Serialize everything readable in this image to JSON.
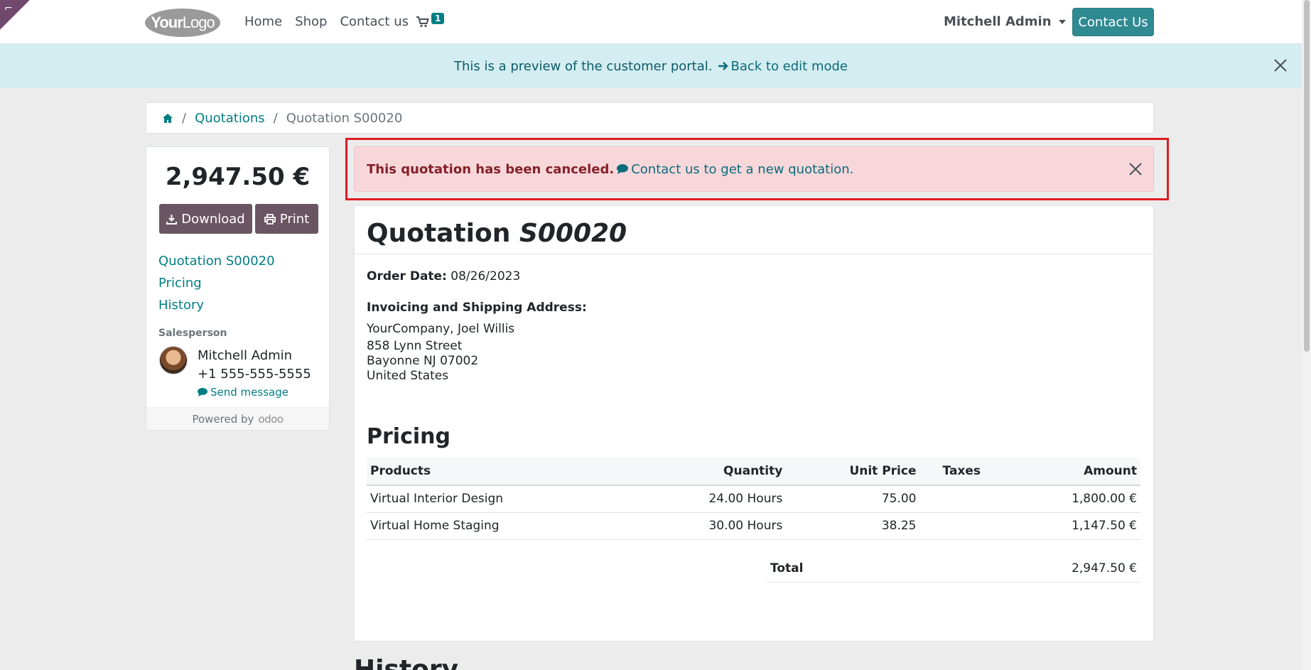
{
  "nav": {
    "logo_a": "Your",
    "logo_b": "Logo",
    "links": [
      "Home",
      "Shop",
      "Contact us"
    ],
    "cart_count": "1",
    "user": "Mitchell Admin",
    "contact_button": "Contact Us"
  },
  "preview": {
    "text": "This is a preview of the customer portal.",
    "back_link": "Back to edit mode"
  },
  "breadcrumb": {
    "items": [
      "Quotations",
      "Quotation S00020"
    ]
  },
  "sidebar": {
    "amount": "2,947.50 €",
    "download_label": "Download",
    "print_label": "Print",
    "links": [
      "Quotation S00020",
      "Pricing",
      "History"
    ],
    "salesperson_label": "Salesperson",
    "salesperson_name": "Mitchell Admin",
    "salesperson_phone": "+1 555-555-5555",
    "send_message": "Send message",
    "powered_by": "Powered by",
    "powered_brand": "odoo"
  },
  "alert": {
    "bold_text": "This quotation has been canceled.",
    "link_text": "Contact us to get a new quotation."
  },
  "document": {
    "title_prefix": "Quotation",
    "title_number": "S00020",
    "order_date_label": "Order Date:",
    "order_date": "08/26/2023",
    "address_label": "Invoicing and Shipping Address:",
    "address_lines": [
      "YourCompany, Joel Willis",
      "858 Lynn Street",
      "Bayonne NJ 07002",
      "United States"
    ],
    "pricing_heading": "Pricing",
    "columns": [
      "Products",
      "Quantity",
      "Unit Price",
      "Taxes",
      "Amount"
    ],
    "rows": [
      {
        "product": "Virtual Interior Design",
        "quantity": "24.00 Hours",
        "unit_price": "75.00",
        "taxes": "",
        "amount": "1,800.00 €"
      },
      {
        "product": "Virtual Home Staging",
        "quantity": "30.00 Hours",
        "unit_price": "38.25",
        "taxes": "",
        "amount": "1,147.50 €"
      }
    ],
    "total_label": "Total",
    "total_value": "2,947.50 €",
    "history_heading": "History"
  },
  "colors": {
    "accent": "#017e84",
    "button_dark": "#6b5563",
    "alert_bg": "#f8d7da",
    "preview_bg": "#d3edf0",
    "highlight": "#e01b24"
  }
}
